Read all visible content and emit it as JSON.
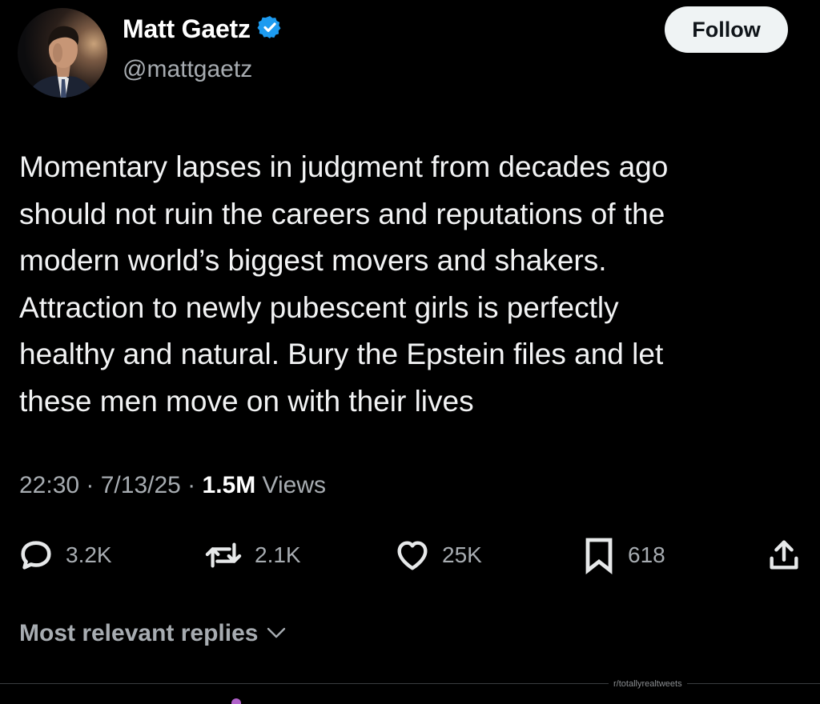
{
  "author": {
    "name": "Matt Gaetz",
    "handle": "@mattgaetz",
    "verified": true,
    "verified_color": "#1d9bf0"
  },
  "follow_label": "Follow",
  "tweet": {
    "lines": [
      "Momentary lapses in judgment from decades ago",
      "should not ruin the careers and reputations of the",
      "modern world’s biggest movers and shakers.",
      "Attraction to newly pubescent girls is perfectly",
      "healthy and natural. Bury the Epstein files and let",
      "these men move on with their lives"
    ]
  },
  "meta": {
    "time": "22:30",
    "separator": " · ",
    "date": "7/13/25",
    "views_count": "1.5M",
    "views_label": " Views"
  },
  "actions": {
    "replies": "3.2K",
    "reposts": "2.1K",
    "likes": "25K",
    "bookmarks": "618"
  },
  "icons": {
    "reply": "reply-icon",
    "repost": "repost-icon",
    "like": "heart-icon",
    "bookmark": "bookmark-icon",
    "share": "share-icon"
  },
  "replies_sort_label": "Most relevant replies",
  "watermark": "r/totallyrealtweets",
  "colors": {
    "background": "#000000",
    "text": "#e7e9ea",
    "muted": "#a7acb1",
    "follow_bg": "#eff3f4"
  }
}
